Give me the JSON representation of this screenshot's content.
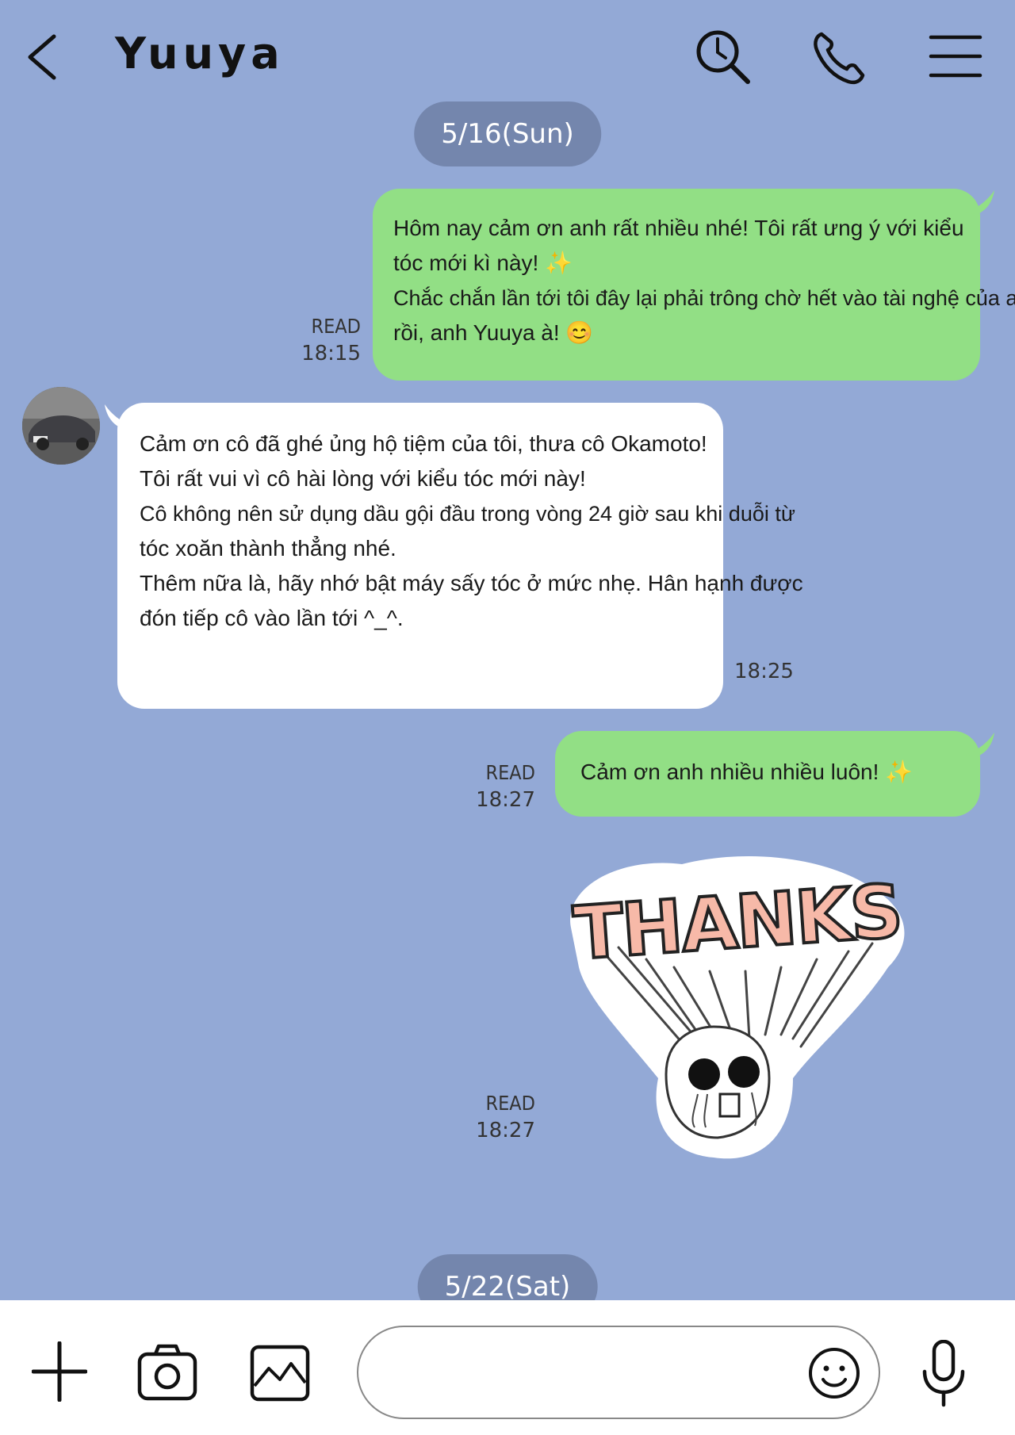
{
  "header": {
    "title": "Yuuya"
  },
  "dates": [
    "5/16(Sun)",
    "5/22(Sat)"
  ],
  "messages": [
    {
      "side": "right",
      "lines": [
        "Hôm nay cảm ơn anh rất nhiều nhé! Tôi rất ưng ý với kiểu",
        "tóc mới kì này! ✨",
        "Chắc chắn lần tới tôi đây lại phải trông chờ hết vào tài nghệ của anh",
        "rồi, anh Yuuya à!  😊"
      ],
      "status": "READ",
      "time": "18:15"
    },
    {
      "side": "left",
      "lines": [
        "Cảm ơn cô đã ghé ủng hộ tiệm của tôi, thưa cô Okamoto!",
        "Tôi rất vui vì cô hài lòng với kiểu tóc mới này!",
        "Cô không nên sử dụng dầu gội đầu trong vòng 24 giờ sau khi duỗi từ",
        "tóc xoăn thành thẳng nhé.",
        "Thêm nữa là, hãy nhớ bật máy sấy tóc ở mức nhẹ. Hân hạnh được",
        "đón tiếp cô vào lần tới ^_^."
      ],
      "time": "18:25"
    },
    {
      "side": "right",
      "lines": [
        "Cảm ơn anh nhiều nhiều luôn!  ✨"
      ],
      "status": "READ",
      "time": "18:27"
    },
    {
      "side": "right",
      "sticker_text": "THANKS",
      "status": "READ",
      "time": "18:27"
    }
  ],
  "colors": {
    "background": "#93a9d6",
    "outgoing_bubble": "#92df85",
    "incoming_bubble": "#ffffff",
    "date_pill": "#7486ad",
    "footer": "#ffffff"
  },
  "icons": [
    "back-icon",
    "search-icon",
    "phone-icon",
    "menu-icon",
    "plus-icon",
    "camera-icon",
    "image-icon",
    "emoji-icon",
    "microphone-icon"
  ]
}
